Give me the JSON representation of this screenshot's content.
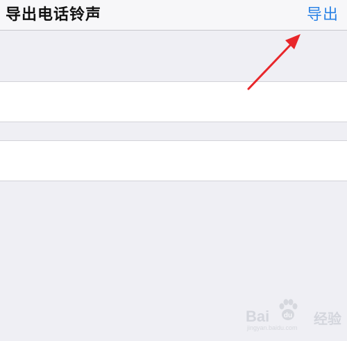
{
  "nav": {
    "title": "导出电话铃声",
    "export_label": "导出",
    "accent_color": "#2b83e6"
  },
  "list": {
    "cells": [
      {
        "label": ""
      },
      {
        "label": ""
      }
    ]
  },
  "annotation": {
    "arrow_color": "#e8262a"
  },
  "watermark": {
    "brand_left": "Bai",
    "brand_right": "经验",
    "url": "jingyan.baidu.com",
    "icon": "paw-icon"
  }
}
